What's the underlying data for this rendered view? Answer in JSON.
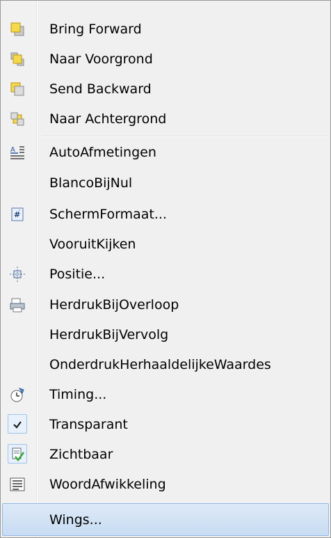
{
  "menu": {
    "items": [
      {
        "label": "Bring Forward",
        "icon": "bring-forward-icon"
      },
      {
        "label": "Naar Voorgrond",
        "icon": "bring-to-front-icon"
      },
      {
        "label": "Send Backward",
        "icon": "send-backward-icon"
      },
      {
        "label": "Naar Achtergrond",
        "icon": "send-to-back-icon"
      },
      {
        "label": "AutoAfmetingen",
        "icon": "auto-size-icon"
      },
      {
        "label": "BlancoBijNul",
        "icon": ""
      },
      {
        "label": "SchermFormaat...",
        "icon": "display-format-icon"
      },
      {
        "label": "VooruitKijken",
        "icon": ""
      },
      {
        "label": "Positie...",
        "icon": "position-icon"
      },
      {
        "label": "HerdrukBijOverloop",
        "icon": "reprint-icon"
      },
      {
        "label": "HerdrukBijVervolg",
        "icon": ""
      },
      {
        "label": "OnderdrukHerhaaldelijkeWaardes",
        "icon": ""
      },
      {
        "label": "Timing...",
        "icon": "timing-icon"
      },
      {
        "label": "Transparant",
        "icon": "checkmark-icon",
        "checked": true
      },
      {
        "label": "Zichtbaar",
        "icon": "visible-icon",
        "checked": true
      },
      {
        "label": "WoordAfwikkeling",
        "icon": "word-wrap-icon"
      },
      {
        "label": "Wings...",
        "icon": "",
        "highlighted": true
      }
    ]
  }
}
